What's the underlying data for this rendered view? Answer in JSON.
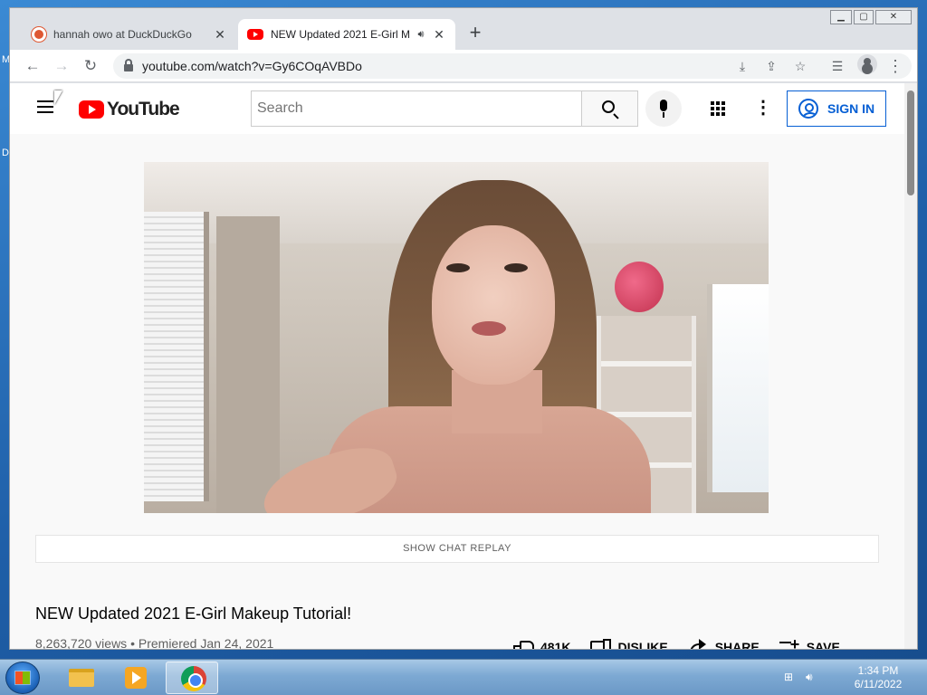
{
  "browser": {
    "tabs": [
      {
        "title": "hannah owo at DuckDuckGo",
        "active": false,
        "icon": "duckduckgo-favicon"
      },
      {
        "title": "NEW Updated 2021 E-Girl M",
        "active": true,
        "icon": "youtube-favicon",
        "audio": true
      }
    ],
    "new_tab_glyph": "+",
    "url": "youtube.com/watch?v=Gy6COqAVBDo"
  },
  "youtube": {
    "logo_text": "YouTube",
    "search_placeholder": "Search",
    "sign_in_label": "SIGN IN",
    "chat_replay_label": "SHOW CHAT REPLAY",
    "video": {
      "title": "NEW Updated 2021 E-Girl Makeup Tutorial!",
      "views": "8,263,720 views",
      "premiered": "Premiered Jan 24, 2021"
    },
    "actions": {
      "like_count": "481K",
      "dislike_label": "DISLIKE",
      "share_label": "SHARE",
      "save_label": "SAVE"
    }
  },
  "taskbar": {
    "time": "1:34 PM",
    "date": "6/11/2022"
  },
  "desktop": {
    "edge_letters": [
      "M",
      "D"
    ]
  }
}
